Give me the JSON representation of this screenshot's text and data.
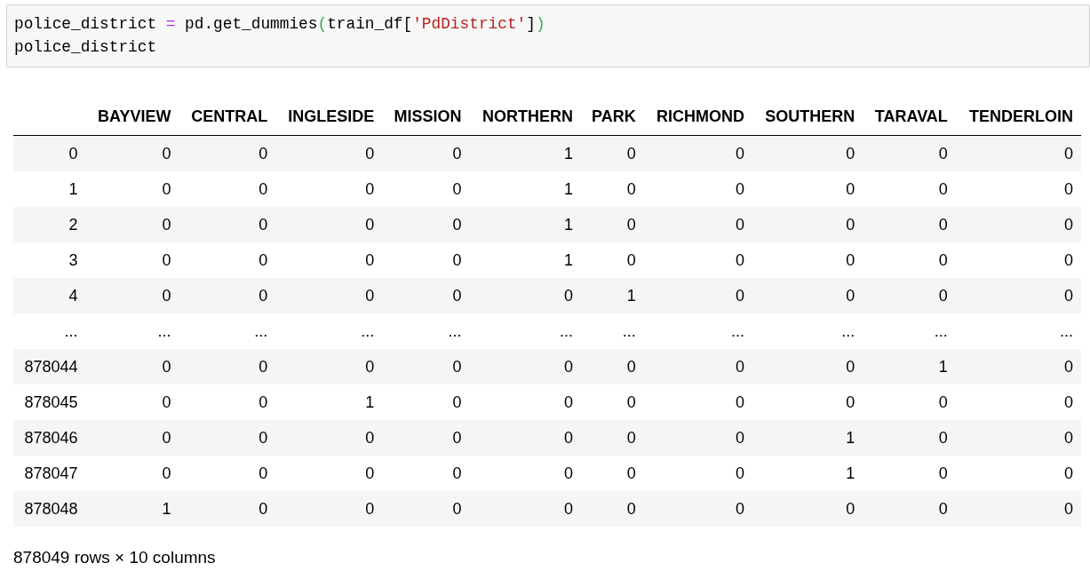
{
  "code_cell": {
    "lines": [
      [
        {
          "text": "police_district ",
          "kind": "name"
        },
        {
          "text": "=",
          "kind": "operator"
        },
        {
          "text": " pd.get_dummies",
          "kind": "name"
        },
        {
          "text": "(",
          "kind": "paren"
        },
        {
          "text": "train_df[",
          "kind": "name"
        },
        {
          "text": "'PdDistrict'",
          "kind": "string"
        },
        {
          "text": "]",
          "kind": "name"
        },
        {
          "text": ")",
          "kind": "paren"
        }
      ],
      [
        {
          "text": "police_district",
          "kind": "name"
        }
      ]
    ]
  },
  "table": {
    "columns": [
      "BAYVIEW",
      "CENTRAL",
      "INGLESIDE",
      "MISSION",
      "NORTHERN",
      "PARK",
      "RICHMOND",
      "SOUTHERN",
      "TARAVAL",
      "TENDERLOIN"
    ],
    "rows": [
      {
        "index": "0",
        "cells": [
          "0",
          "0",
          "0",
          "0",
          "1",
          "0",
          "0",
          "0",
          "0",
          "0"
        ]
      },
      {
        "index": "1",
        "cells": [
          "0",
          "0",
          "0",
          "0",
          "1",
          "0",
          "0",
          "0",
          "0",
          "0"
        ]
      },
      {
        "index": "2",
        "cells": [
          "0",
          "0",
          "0",
          "0",
          "1",
          "0",
          "0",
          "0",
          "0",
          "0"
        ]
      },
      {
        "index": "3",
        "cells": [
          "0",
          "0",
          "0",
          "0",
          "1",
          "0",
          "0",
          "0",
          "0",
          "0"
        ]
      },
      {
        "index": "4",
        "cells": [
          "0",
          "0",
          "0",
          "0",
          "0",
          "1",
          "0",
          "0",
          "0",
          "0"
        ]
      },
      {
        "index": "...",
        "cells": [
          "...",
          "...",
          "...",
          "...",
          "...",
          "...",
          "...",
          "...",
          "...",
          "..."
        ]
      },
      {
        "index": "878044",
        "cells": [
          "0",
          "0",
          "0",
          "0",
          "0",
          "0",
          "0",
          "0",
          "1",
          "0"
        ]
      },
      {
        "index": "878045",
        "cells": [
          "0",
          "0",
          "1",
          "0",
          "0",
          "0",
          "0",
          "0",
          "0",
          "0"
        ]
      },
      {
        "index": "878046",
        "cells": [
          "0",
          "0",
          "0",
          "0",
          "0",
          "0",
          "0",
          "1",
          "0",
          "0"
        ]
      },
      {
        "index": "878047",
        "cells": [
          "0",
          "0",
          "0",
          "0",
          "0",
          "0",
          "0",
          "1",
          "0",
          "0"
        ]
      },
      {
        "index": "878048",
        "cells": [
          "1",
          "0",
          "0",
          "0",
          "0",
          "0",
          "0",
          "0",
          "0",
          "0"
        ]
      }
    ]
  },
  "footer": "878049 rows × 10 columns"
}
